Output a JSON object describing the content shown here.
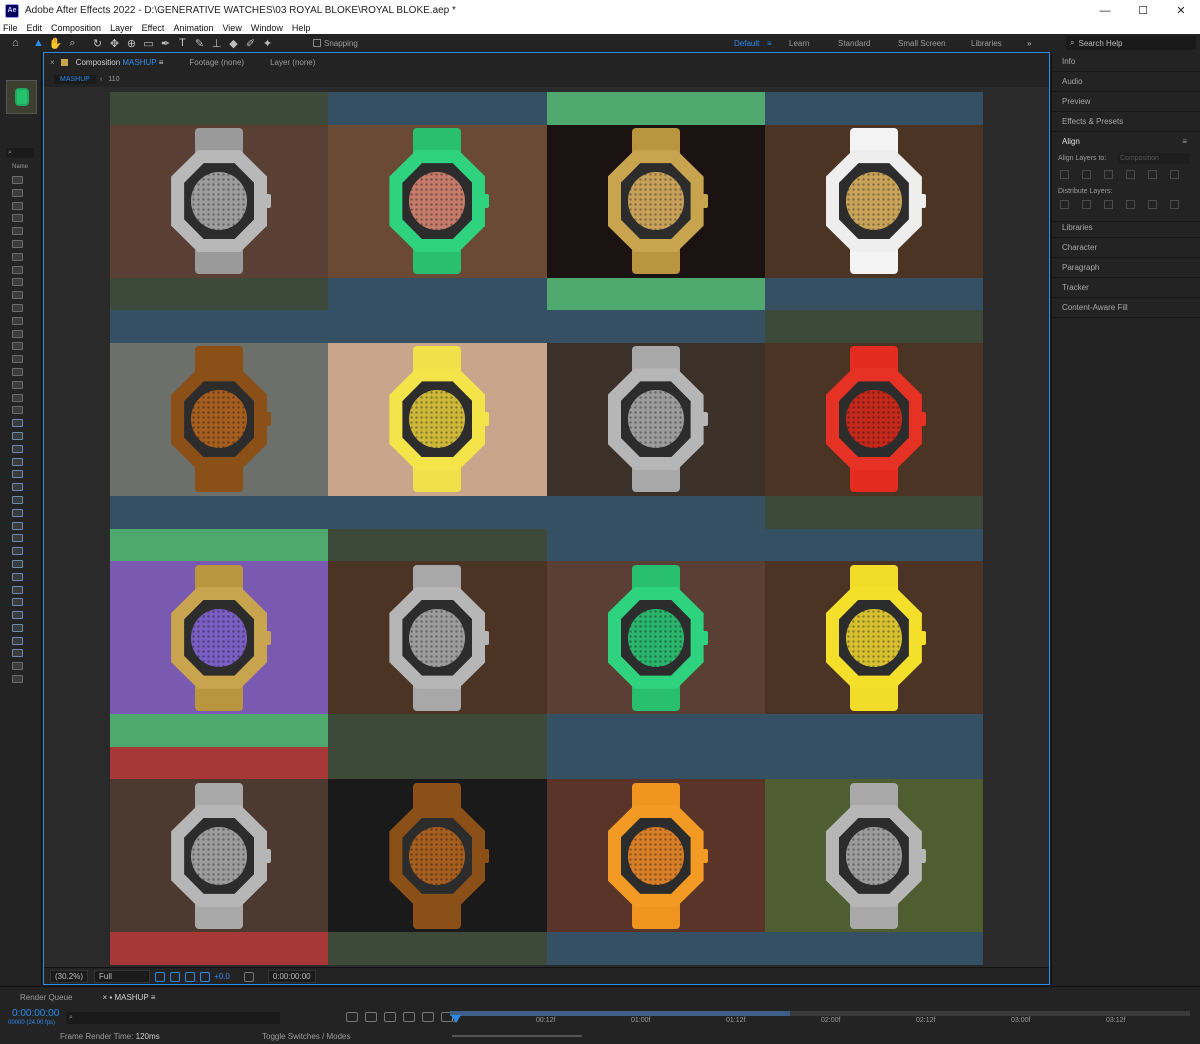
{
  "titlebar": {
    "app_icon": "Ae",
    "title": "Adobe After Effects 2022 - D:\\GENERATIVE WATCHES\\03 ROYAL BLOKE\\ROYAL BLOKE.aep *",
    "minimize": "—",
    "maximize": "☐",
    "close": "✕"
  },
  "menu": [
    "File",
    "Edit",
    "Composition",
    "Layer",
    "Effect",
    "Animation",
    "View",
    "Window",
    "Help"
  ],
  "toolbar": {
    "snapping_label": "Snapping",
    "workspaces": [
      "Default",
      "Learn",
      "Standard",
      "Small Screen",
      "Libraries"
    ],
    "active_workspace": "Default",
    "more": "»",
    "search_placeholder": "Search Help",
    "tools": [
      "home-icon",
      "selection-icon",
      "hand-icon",
      "zoom-icon",
      "rotate-icon",
      "camera-icon",
      "pan-behind-icon",
      "rectangle-icon",
      "pen-icon",
      "type-icon",
      "brush-icon",
      "clone-stamp-icon",
      "eraser-icon",
      "roto-brush-icon",
      "puppet-pin-icon"
    ]
  },
  "project": {
    "search_placeholder": "",
    "name_column": "Name"
  },
  "composition": {
    "tab_prefix": "Composition",
    "tab_name": "MASHUP",
    "footage_tab": "Footage (none)",
    "layer_tab": "Layer (none)",
    "breadcrumb": "MASHUP",
    "breadcrumb_num": "110",
    "zoom": "(30.2%)",
    "resolution": "Full",
    "exposure": "+0.0",
    "timecode": "0:00:00:00"
  },
  "tiles": [
    {
      "bg": "#3d4a3a",
      "arm": "#5a4034",
      "case": "#b8b8b8",
      "strap": "#9a9a9a",
      "dial": "#9d9d9d"
    },
    {
      "bg": "#355062",
      "arm": "#6b4a35",
      "case": "#2fd27e",
      "strap": "#28c06f",
      "dial": "#c37b6a"
    },
    {
      "bg": "#4fa86d",
      "arm": "#1b1312",
      "case": "#c9a44e",
      "strap": "#b9953f",
      "dial": "#c7a15a"
    },
    {
      "bg": "#355062",
      "arm": "#4c3424",
      "case": "#eeeeee",
      "strap": "#f4f4f4",
      "dial": "#c8a35a"
    },
    {
      "bg": "#355062",
      "arm": "#6d6f6b",
      "case": "#8a5018",
      "strap": "#8a5018",
      "dial": "#a45e20"
    },
    {
      "bg": "#355062",
      "arm": "#c9a58c",
      "case": "#f4e44a",
      "strap": "#f1e04a",
      "dial": "#cdb83a"
    },
    {
      "bg": "#355062",
      "arm": "#3c3128",
      "case": "#b6b6b6",
      "strap": "#a8a8a8",
      "dial": "#9c9c9c"
    },
    {
      "bg": "#3d4a3a",
      "arm": "#4c3424",
      "case": "#e63224",
      "strap": "#e32c1f",
      "dial": "#c2291c"
    },
    {
      "bg": "#4fa86d",
      "arm": "#7a5ab0",
      "case": "#c9a44e",
      "strap": "#b9953f",
      "dial": "#7a5ec2"
    },
    {
      "bg": "#3d4a3a",
      "arm": "#4c3424",
      "case": "#b6b6b6",
      "strap": "#a8a8a8",
      "dial": "#9c9c9c"
    },
    {
      "bg": "#355062",
      "arm": "#5a4034",
      "case": "#2fd27e",
      "strap": "#28c06f",
      "dial": "#2ab46c"
    },
    {
      "bg": "#355062",
      "arm": "#4c3424",
      "case": "#f4e02a",
      "strap": "#f1dc2a",
      "dial": "#d6c030"
    },
    {
      "bg": "#a83838",
      "arm": "#4c3a30",
      "case": "#b6b6b6",
      "strap": "#a8a8a8",
      "dial": "#9c9c9c"
    },
    {
      "bg": "#3d4a3a",
      "arm": "#1a1a1a",
      "case": "#8a5018",
      "strap": "#8a5018",
      "dial": "#a45e20"
    },
    {
      "bg": "#355062",
      "arm": "#5a3428",
      "case": "#f39a24",
      "strap": "#f09420",
      "dial": "#d77e28"
    },
    {
      "bg": "#355062",
      "arm": "#4f5e30",
      "case": "#b6b6b6",
      "strap": "#a8a8a8",
      "dial": "#9c9c9c"
    }
  ],
  "right_panels": {
    "items_top": [
      "Info",
      "Audio",
      "Preview",
      "Effects & Presets"
    ],
    "align_title": "Align",
    "align_layers_to": "Align Layers to:",
    "align_target": "Composition",
    "distribute_layers": "Distribute Layers:",
    "items_bottom": [
      "Libraries",
      "Character",
      "Paragraph",
      "Tracker",
      "Content-Aware Fill"
    ]
  },
  "timeline": {
    "render_queue_tab": "Render Queue",
    "comp_tab": "MASHUP",
    "timecode": "0:00:00:00",
    "frames": "00000 (24.00 fps)",
    "search_placeholder": "",
    "ruler_labels": [
      "0f",
      "00:12f",
      "01:00f",
      "01:12f",
      "02:00f",
      "02:12f",
      "03:00f",
      "03:12f"
    ],
    "frame_render_label": "Frame Render Time:",
    "frame_render_value": "120ms",
    "toggle_label": "Toggle Switches / Modes"
  },
  "colors": {
    "accent": "#2d8ceb",
    "panel": "#232323",
    "viewer": "#2a2a2a"
  }
}
